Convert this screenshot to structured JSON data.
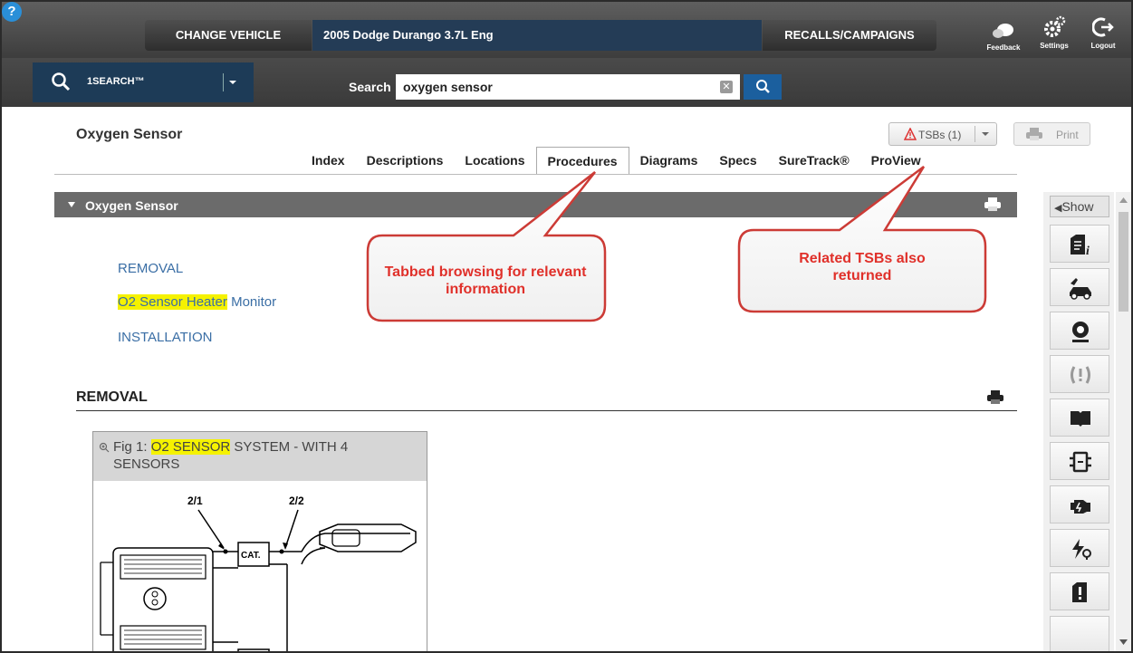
{
  "topbar": {
    "change_vehicle": "CHANGE VEHICLE",
    "vehicle": "2005 Dodge Durango 3.7L Eng",
    "recalls": "RECALLS/CAMPAIGNS",
    "help": "?",
    "feedback": "Feedback",
    "settings": "Settings",
    "logout": "Logout"
  },
  "searchbar": {
    "onesearch": "1SEARCH™",
    "label": "Search",
    "query": "oxygen sensor",
    "clear": "✕"
  },
  "header": {
    "title": "Oxygen Sensor",
    "tsb_button": "TSBs (1)",
    "print_button": "Print"
  },
  "tabs": [
    "Index",
    "Descriptions",
    "Locations",
    "Procedures",
    "Diagrams",
    "Specs",
    "SureTrack®",
    "ProView"
  ],
  "active_tab": "Procedures",
  "section": {
    "title": "Oxygen Sensor"
  },
  "toc": {
    "removal": "REMOVAL",
    "heater_hl": "O2 Sensor Heater",
    "heater_rest": " Monitor",
    "installation": "INSTALLATION"
  },
  "removal_heading": "REMOVAL",
  "figure": {
    "prefix": "Fig 1: ",
    "highlight": "O2 SENSOR",
    "rest": " SYSTEM - WITH 4 SENSORS",
    "label_a": "2/1",
    "label_b": "2/2",
    "cat": "CAT."
  },
  "sidebar": {
    "show": "Show"
  },
  "callouts": {
    "tabs": "Tabbed browsing for relevant information",
    "tsbs": "Related TSBs also returned"
  },
  "colors": {
    "callout_red": "#e0302a",
    "link_blue": "#3a6ea5",
    "highlight_yellow": "#f5f200",
    "vehicle_bar": "#243c56"
  }
}
